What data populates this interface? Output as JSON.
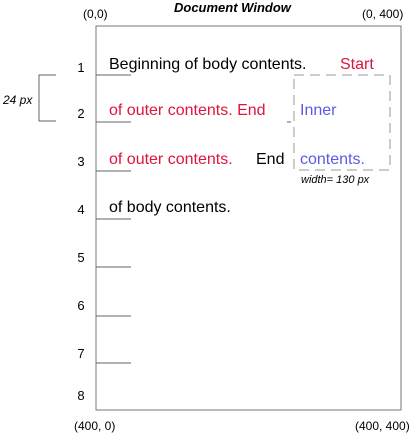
{
  "title": "Document Window",
  "corners": {
    "top_left": "(0,0)",
    "top_right": "(0, 400)",
    "bottom_left": "(400, 0)",
    "bottom_right": "(400, 400)"
  },
  "line_numbers": [
    "1",
    "2",
    "3",
    "4",
    "5",
    "6",
    "7",
    "8"
  ],
  "line_height_label": "24 px",
  "width_label": "width= 130 px",
  "text_runs": {
    "line1_black": "Beginning of body contents.",
    "line1_red": "Start",
    "line2_red": "of outer contents. End",
    "line3_red": "of outer contents.",
    "line3_black": "End",
    "line4_black": "of body contents.",
    "inner_line1": "Inner",
    "inner_line2": "contents."
  },
  "colors": {
    "body_text": "#000000",
    "outer_text": "#e0143c",
    "inner_text": "#5a5ae6",
    "lines": "#666666",
    "dash_box": "#999999"
  }
}
